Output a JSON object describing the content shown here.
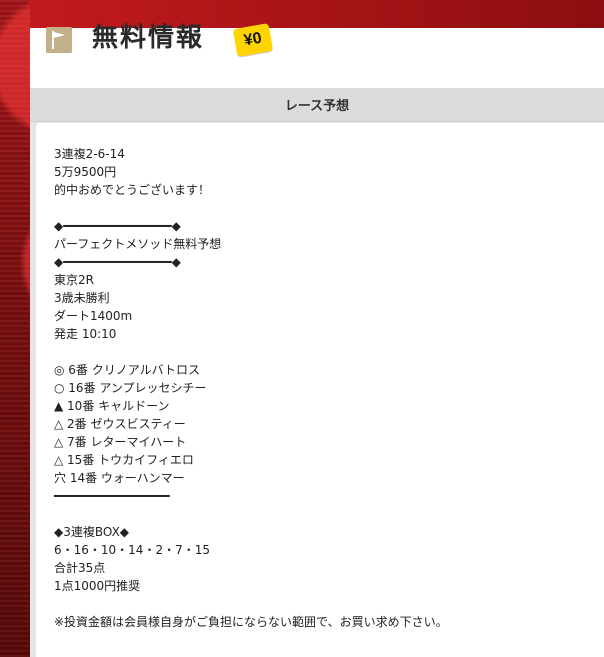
{
  "header": {
    "title": "無料情報",
    "badge": "¥0"
  },
  "section": {
    "title": "レース予想"
  },
  "content": {
    "body": "3連複2-6-14\n5万9500円\n的中おめでとうございます！\n\n◆━━━━━━━━━━━━━━━◆\nパーフェクトメソッド無料予想\n◆━━━━━━━━━━━━━━━◆\n東京2R\n3歳未勝利\nダート1400m\n発走 10:10\n\n◎ 6番 クリノアルバトロス\n○ 16番 アンプレッセシチー\n▲ 10番 キャルドーン\n△ 2番 ゼウスビスティー\n△ 7番 レターマイハート\n△ 15番 トウカイフィエロ\n穴 14番 ウォーハンマー\n━━━━━━━━━━━━━━━━\n\n◆3連複BOX◆\n6・16・10・14・2・7・15\n合計35点\n1点1000円推奨\n\n※投資金額は会員様自身がご負担にならない範囲で、お買い求め下さい。"
  },
  "colors": {
    "backdrop": "#a7161a",
    "badge": "#ffd400",
    "panel": "#ffffff",
    "section_header": "#dcdcdc"
  },
  "icons": {
    "title_icon": "flag-icon"
  }
}
